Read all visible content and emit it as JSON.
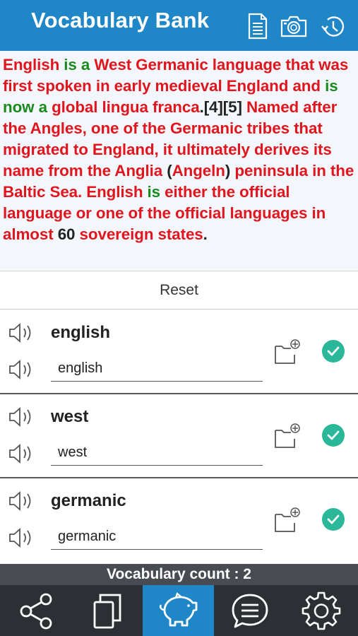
{
  "app": {
    "title": "Vocabulary Bank",
    "accent_color": "#1f86c8",
    "header_icons": [
      "document-icon",
      "camera-icon",
      "history-icon"
    ]
  },
  "passage": {
    "segments": [
      {
        "text": "English",
        "color": "red"
      },
      {
        "text": " is a ",
        "color": "green"
      },
      {
        "text": "West Germanic language that was first spoken in early medieval England and",
        "color": "red"
      },
      {
        "text": " is now a ",
        "color": "green"
      },
      {
        "text": "global lingua franca",
        "color": "red"
      },
      {
        "text": ".[4][5]",
        "color": "black"
      },
      {
        "text": " Named after the Angles, one of the Germanic tribes that migrated to England, it ultimately derives its name from the Anglia ",
        "color": "red"
      },
      {
        "text": "(",
        "color": "black"
      },
      {
        "text": "Angeln",
        "color": "red"
      },
      {
        "text": ")",
        "color": "black"
      },
      {
        "text": " peninsula in the Baltic Sea. English",
        "color": "red"
      },
      {
        "text": " is ",
        "color": "green"
      },
      {
        "text": "either the official language or one of the official languages in almost ",
        "color": "red"
      },
      {
        "text": "60",
        "color": "black"
      },
      {
        "text": " sovereign states",
        "color": "red"
      },
      {
        "text": ".",
        "color": "black"
      }
    ]
  },
  "reset_label": "Reset",
  "vocab_items": [
    {
      "word": "english",
      "input_value": "english"
    },
    {
      "word": "west",
      "input_value": "west"
    },
    {
      "word": "germanic",
      "input_value": "germanic"
    }
  ],
  "footer": {
    "count_text": "Vocabulary count : 2",
    "tabs": [
      {
        "icon": "share-icon",
        "active": false
      },
      {
        "icon": "copy-icon",
        "active": false
      },
      {
        "icon": "piggy-bank-icon",
        "active": true
      },
      {
        "icon": "chat-icon",
        "active": false
      },
      {
        "icon": "settings-icon",
        "active": false
      }
    ]
  }
}
